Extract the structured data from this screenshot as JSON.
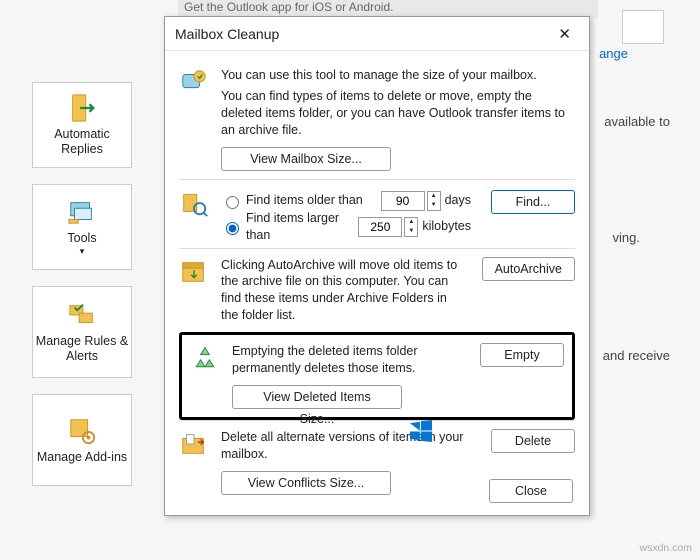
{
  "background": {
    "topbar": "Get the Outlook app for iOS or Android.",
    "link_change": "ange",
    "text_available": "available to",
    "text_ving": "ving.",
    "text_receive": "and receive"
  },
  "ribbon": [
    {
      "label": "Automatic Replies"
    },
    {
      "label": "Tools"
    },
    {
      "label": "Manage Rules & Alerts"
    },
    {
      "label": "Manage Add-ins"
    }
  ],
  "dialog": {
    "title": "Mailbox Cleanup",
    "intro": "You can use this tool to manage the size of your mailbox.",
    "intro2": "You can find types of items to delete or move, empty the deleted items folder, or you can have Outlook transfer items to an archive file.",
    "view_mailbox": "View Mailbox Size...",
    "older_label": "Find items older than",
    "older_value": "90",
    "older_unit": "days",
    "larger_label": "Find items larger than",
    "larger_value": "250",
    "larger_unit": "kilobytes",
    "find_btn": "Find...",
    "autoarchive_text": "Clicking AutoArchive will move old items to the archive file on this computer. You can find these items under Archive Folders in the folder list.",
    "autoarchive_btn": "AutoArchive",
    "empty_text": "Emptying the deleted items folder permanently deletes those items.",
    "empty_btn": "Empty",
    "view_deleted": "View Deleted Items Size...",
    "conflicts_text": "Delete all alternate versions of items in your mailbox.",
    "delete_btn": "Delete",
    "view_conflicts": "View Conflicts Size...",
    "close_btn": "Close"
  },
  "watermark": "wsxdn.com"
}
